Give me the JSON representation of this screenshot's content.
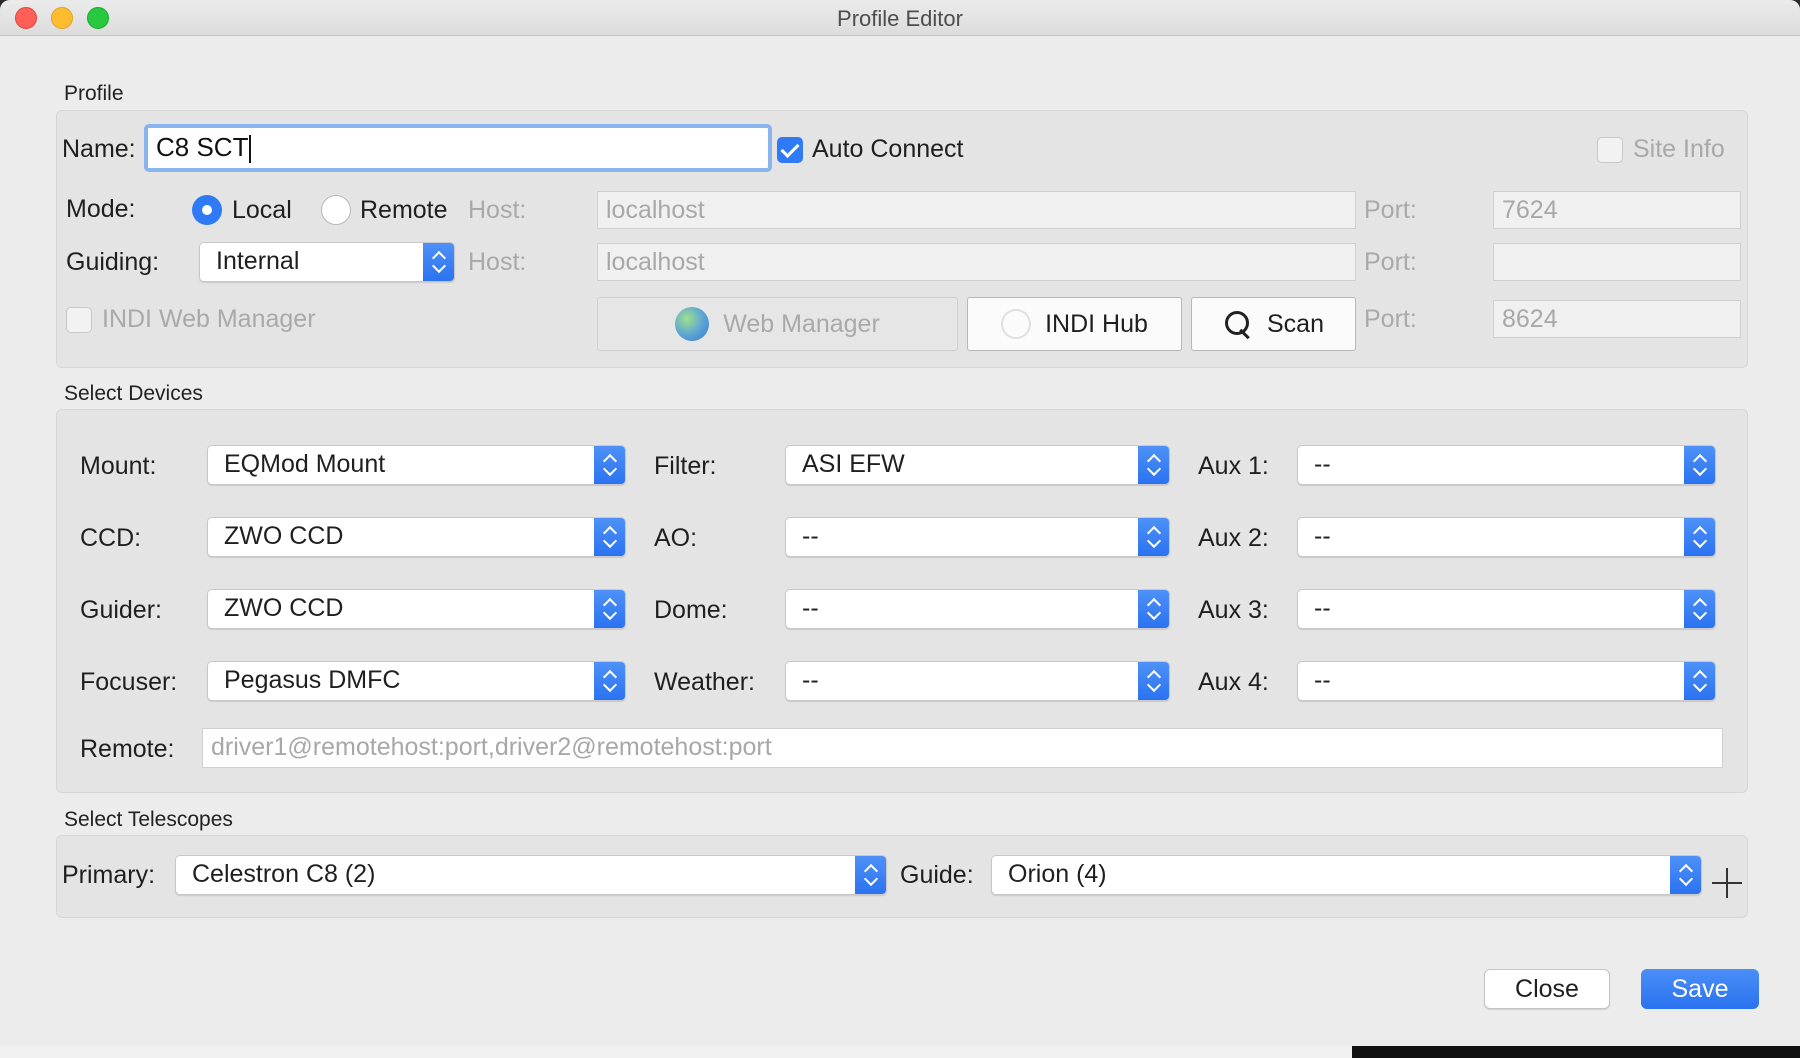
{
  "window": {
    "title": "Profile Editor"
  },
  "profile": {
    "section_title": "Profile",
    "name_label": "Name:",
    "name_value": "C8 SCT",
    "auto_connect_label": "Auto Connect",
    "auto_connect_checked": true,
    "site_info_label": "Site Info",
    "site_info_checked": false,
    "mode_label": "Mode:",
    "mode_local_label": "Local",
    "mode_remote_label": "Remote",
    "mode_selected": "Local",
    "host_label": "Host:",
    "host_value": "localhost",
    "port_label": "Port:",
    "port_value": "7624",
    "guiding_label": "Guiding:",
    "guiding_value": "Internal",
    "guiding_host_label": "Host:",
    "guiding_host_value": "localhost",
    "guiding_port_label": "Port:",
    "guiding_port_value": "",
    "web_manager_check_label": "INDI Web Manager",
    "web_manager_checked": false,
    "web_manager_button": "Web Manager",
    "indi_hub_button": "INDI Hub",
    "scan_button": "Scan",
    "web_port_label": "Port:",
    "web_port_value": "8624"
  },
  "devices": {
    "section_title": "Select Devices",
    "mount": {
      "label": "Mount:",
      "value": "EQMod Mount"
    },
    "ccd": {
      "label": "CCD:",
      "value": "ZWO CCD"
    },
    "guider": {
      "label": "Guider:",
      "value": "ZWO CCD"
    },
    "focuser": {
      "label": "Focuser:",
      "value": "Pegasus DMFC"
    },
    "filter": {
      "label": "Filter:",
      "value": "ASI EFW"
    },
    "ao": {
      "label": "AO:",
      "value": "--"
    },
    "dome": {
      "label": "Dome:",
      "value": "--"
    },
    "weather": {
      "label": "Weather:",
      "value": "--"
    },
    "aux1": {
      "label": "Aux 1:",
      "value": "--"
    },
    "aux2": {
      "label": "Aux 2:",
      "value": "--"
    },
    "aux3": {
      "label": "Aux 3:",
      "value": "--"
    },
    "aux4": {
      "label": "Aux 4:",
      "value": "--"
    },
    "remote_label": "Remote:",
    "remote_placeholder": "driver1@remotehost:port,driver2@remotehost:port"
  },
  "telescopes": {
    "section_title": "Select Telescopes",
    "primary_label": "Primary:",
    "primary_value": "Celestron C8 (2)",
    "guide_label": "Guide:",
    "guide_value": "Orion  (4)"
  },
  "footer": {
    "close_label": "Close",
    "save_label": "Save"
  },
  "colors": {
    "accent": "#2f7bf6",
    "window_bg": "#ececec",
    "group_bg": "#e4e4e4"
  },
  "icons": {
    "web_manager": "globe-icon",
    "indi_hub": "hub-icon",
    "scan": "search-icon",
    "add": "plus-icon"
  }
}
